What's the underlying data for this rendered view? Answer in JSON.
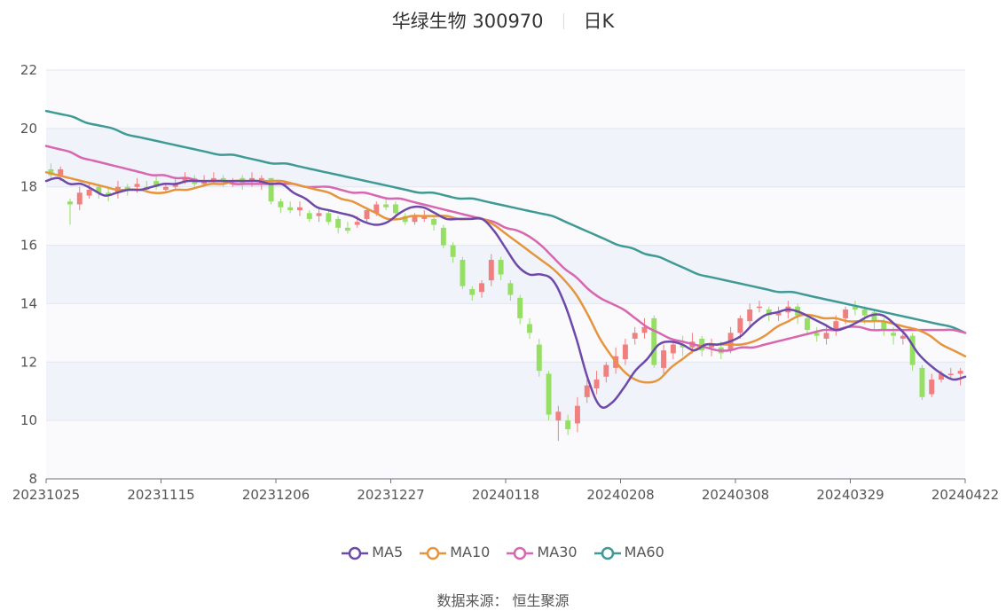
{
  "header": {
    "stock": "华绿生物 300970",
    "period": "日K"
  },
  "source_label": "数据来源：",
  "source_name": "恒生聚源",
  "colors": {
    "up": "#f07f7f",
    "down": "#95e063",
    "MA5": "#6e4aa8",
    "MA10": "#e6953d",
    "MA30": "#d767b0",
    "MA60": "#3f9a95"
  },
  "chart_data": {
    "type": "candlestick",
    "title": "华绿生物 300970 日K",
    "ylim": [
      8,
      22
    ],
    "yticks": [
      8,
      10,
      12,
      14,
      16,
      18,
      20,
      22
    ],
    "xtick_labels": [
      "20231025",
      "20231115",
      "20231206",
      "20231227",
      "20240118",
      "20240208",
      "20240308",
      "20240329",
      "20240422"
    ],
    "grid": true,
    "legend_position": "bottom",
    "series": [
      {
        "name": "MA5",
        "values": [
          18.2,
          18.3,
          18.1,
          18.1,
          17.9,
          17.7,
          17.8,
          17.9,
          17.9,
          18.0,
          18.1,
          18.1,
          18.2,
          18.2,
          18.2,
          18.2,
          18.2,
          18.2,
          18.2,
          18.1,
          18.1,
          17.8,
          17.6,
          17.3,
          17.2,
          17.1,
          17.0,
          16.8,
          16.7,
          16.8,
          17.1,
          17.3,
          17.3,
          17.1,
          16.9,
          16.9,
          16.9,
          16.9,
          16.5,
          15.9,
          15.3,
          15.0,
          15.0,
          14.8,
          14.0,
          12.8,
          11.4,
          10.5,
          10.6,
          11.1,
          11.7,
          12.1,
          12.6,
          12.7,
          12.6,
          12.4,
          12.6,
          12.6,
          12.7,
          12.9,
          13.3,
          13.6,
          13.7,
          13.8,
          13.7,
          13.5,
          13.3,
          13.1,
          13.2,
          13.4,
          13.6,
          13.6,
          13.3,
          12.9,
          12.3,
          11.9,
          11.6,
          11.4,
          11.5
        ]
      },
      {
        "name": "MA10",
        "values": [
          18.5,
          18.4,
          18.3,
          18.2,
          18.1,
          18.0,
          17.9,
          17.9,
          17.9,
          17.8,
          17.8,
          17.9,
          17.9,
          18.0,
          18.1,
          18.1,
          18.2,
          18.2,
          18.2,
          18.2,
          18.2,
          18.1,
          18.0,
          17.9,
          17.8,
          17.6,
          17.5,
          17.3,
          17.1,
          16.9,
          16.9,
          17.0,
          17.0,
          17.0,
          17.0,
          16.9,
          16.9,
          16.9,
          16.7,
          16.4,
          16.1,
          15.8,
          15.5,
          15.2,
          14.8,
          14.3,
          13.6,
          12.8,
          12.2,
          11.7,
          11.4,
          11.3,
          11.4,
          11.8,
          12.1,
          12.4,
          12.6,
          12.6,
          12.6,
          12.6,
          12.7,
          12.9,
          13.2,
          13.4,
          13.6,
          13.6,
          13.5,
          13.5,
          13.4,
          13.4,
          13.4,
          13.4,
          13.3,
          13.2,
          13.1,
          12.9,
          12.6,
          12.4,
          12.2
        ]
      },
      {
        "name": "MA30",
        "values": [
          19.4,
          19.3,
          19.2,
          19.0,
          18.9,
          18.8,
          18.7,
          18.6,
          18.5,
          18.4,
          18.4,
          18.3,
          18.3,
          18.2,
          18.2,
          18.2,
          18.1,
          18.1,
          18.1,
          18.1,
          18.1,
          18.1,
          18.0,
          18.0,
          18.0,
          17.9,
          17.8,
          17.8,
          17.7,
          17.6,
          17.6,
          17.5,
          17.4,
          17.3,
          17.2,
          17.1,
          17.0,
          16.9,
          16.8,
          16.6,
          16.5,
          16.3,
          16.0,
          15.6,
          15.2,
          14.9,
          14.5,
          14.2,
          14.0,
          13.8,
          13.5,
          13.2,
          13.0,
          12.8,
          12.7,
          12.6,
          12.5,
          12.4,
          12.4,
          12.5,
          12.5,
          12.6,
          12.7,
          12.8,
          12.9,
          13.0,
          13.1,
          13.1,
          13.2,
          13.2,
          13.1,
          13.1,
          13.1,
          13.1,
          13.1,
          13.1,
          13.1,
          13.1,
          13.0
        ]
      },
      {
        "name": "MA60",
        "values": [
          20.6,
          20.5,
          20.4,
          20.2,
          20.1,
          20.0,
          19.8,
          19.7,
          19.6,
          19.5,
          19.4,
          19.3,
          19.2,
          19.1,
          19.1,
          19.0,
          18.9,
          18.8,
          18.8,
          18.7,
          18.6,
          18.5,
          18.4,
          18.3,
          18.2,
          18.1,
          18.0,
          17.9,
          17.8,
          17.8,
          17.7,
          17.6,
          17.6,
          17.5,
          17.4,
          17.3,
          17.2,
          17.1,
          17.0,
          16.8,
          16.6,
          16.4,
          16.2,
          16.0,
          15.9,
          15.7,
          15.6,
          15.4,
          15.2,
          15.0,
          14.9,
          14.8,
          14.7,
          14.6,
          14.5,
          14.4,
          14.4,
          14.3,
          14.2,
          14.1,
          14.0,
          13.9,
          13.8,
          13.7,
          13.6,
          13.5,
          13.4,
          13.3,
          13.2,
          13.0
        ]
      },
      {
        "name": "candles",
        "ohlc": [
          [
            18.6,
            18.4,
            18.8,
            18.3
          ],
          [
            18.4,
            18.6,
            18.7,
            18.2
          ],
          [
            17.5,
            17.4,
            17.6,
            16.7
          ],
          [
            17.4,
            17.8,
            18.0,
            17.2
          ],
          [
            17.7,
            17.9,
            18.1,
            17.6
          ],
          [
            18.0,
            17.8,
            18.1,
            17.6
          ],
          [
            17.8,
            17.7,
            18.0,
            17.5
          ],
          [
            17.8,
            18.0,
            18.2,
            17.6
          ],
          [
            18.0,
            17.9,
            18.1,
            17.7
          ],
          [
            18.0,
            18.1,
            18.3,
            17.8
          ],
          [
            18.0,
            17.9,
            18.2,
            17.8
          ],
          [
            18.2,
            18.0,
            18.4,
            17.9
          ],
          [
            17.9,
            18.0,
            18.1,
            17.8
          ],
          [
            18.0,
            18.1,
            18.3,
            17.9
          ],
          [
            18.2,
            18.3,
            18.5,
            18.1
          ],
          [
            18.3,
            18.1,
            18.4,
            18.0
          ],
          [
            18.1,
            18.2,
            18.4,
            18.0
          ],
          [
            18.2,
            18.3,
            18.5,
            18.1
          ],
          [
            18.3,
            18.2,
            18.4,
            18.0
          ],
          [
            18.2,
            18.2,
            18.3,
            18.0
          ],
          [
            18.3,
            18.1,
            18.4,
            17.9
          ],
          [
            18.2,
            18.3,
            18.5,
            18.0
          ],
          [
            18.1,
            18.3,
            18.4,
            17.9
          ],
          [
            18.3,
            17.5,
            18.3,
            17.4
          ],
          [
            17.5,
            17.3,
            17.6,
            17.1
          ],
          [
            17.3,
            17.2,
            17.5,
            17.1
          ],
          [
            17.2,
            17.3,
            17.5,
            17.0
          ],
          [
            17.1,
            16.9,
            17.2,
            16.8
          ],
          [
            17.0,
            17.1,
            17.3,
            16.8
          ],
          [
            17.1,
            16.8,
            17.2,
            16.7
          ],
          [
            16.9,
            16.6,
            17.0,
            16.4
          ],
          [
            16.6,
            16.5,
            16.8,
            16.4
          ],
          [
            16.7,
            16.8,
            17.0,
            16.6
          ],
          [
            16.9,
            17.2,
            17.3,
            16.8
          ],
          [
            17.1,
            17.4,
            17.5,
            17.0
          ],
          [
            17.4,
            17.3,
            17.6,
            17.2
          ],
          [
            17.4,
            17.1,
            17.5,
            16.9
          ],
          [
            17.0,
            16.8,
            17.1,
            16.7
          ],
          [
            16.8,
            17.0,
            17.1,
            16.7
          ],
          [
            16.9,
            17.0,
            17.2,
            16.8
          ],
          [
            16.9,
            16.7,
            17.0,
            16.5
          ],
          [
            16.6,
            16.0,
            16.7,
            15.9
          ],
          [
            16.0,
            15.6,
            16.1,
            15.4
          ],
          [
            15.5,
            14.6,
            15.6,
            14.5
          ],
          [
            14.5,
            14.3,
            14.6,
            14.1
          ],
          [
            14.4,
            14.7,
            14.8,
            14.2
          ],
          [
            14.8,
            15.5,
            15.7,
            14.6
          ],
          [
            15.5,
            15.0,
            15.6,
            14.8
          ],
          [
            14.7,
            14.3,
            14.8,
            14.1
          ],
          [
            14.2,
            13.5,
            14.3,
            13.3
          ],
          [
            13.3,
            13.0,
            13.5,
            12.8
          ],
          [
            12.6,
            11.7,
            12.8,
            11.5
          ],
          [
            11.6,
            10.2,
            11.7,
            10.0
          ],
          [
            10.0,
            10.3,
            10.5,
            9.3
          ],
          [
            10.0,
            9.7,
            10.2,
            9.5
          ],
          [
            9.9,
            10.5,
            10.8,
            9.6
          ],
          [
            10.8,
            11.2,
            11.4,
            10.6
          ],
          [
            11.1,
            11.4,
            11.7,
            10.9
          ],
          [
            11.5,
            11.9,
            12.0,
            11.3
          ],
          [
            11.8,
            12.2,
            12.5,
            11.6
          ],
          [
            12.1,
            12.6,
            12.8,
            11.9
          ],
          [
            12.8,
            13.0,
            13.2,
            12.6
          ],
          [
            13.0,
            13.2,
            13.5,
            12.8
          ],
          [
            13.5,
            11.9,
            13.6,
            11.8
          ],
          [
            11.8,
            12.4,
            12.6,
            11.6
          ],
          [
            12.3,
            12.6,
            12.8,
            12.1
          ],
          [
            12.6,
            12.5,
            12.9,
            12.2
          ],
          [
            12.5,
            12.7,
            13.0,
            12.3
          ],
          [
            12.8,
            12.4,
            12.9,
            12.2
          ],
          [
            12.5,
            12.6,
            12.8,
            12.2
          ],
          [
            12.5,
            12.3,
            12.7,
            12.1
          ],
          [
            12.4,
            13.0,
            13.2,
            12.3
          ],
          [
            13.0,
            13.5,
            13.6,
            12.8
          ],
          [
            13.4,
            13.8,
            14.0,
            13.2
          ],
          [
            13.9,
            13.9,
            14.1,
            13.7
          ],
          [
            13.8,
            13.6,
            13.9,
            13.4
          ],
          [
            13.6,
            13.7,
            13.9,
            13.4
          ],
          [
            13.7,
            13.9,
            14.1,
            13.5
          ],
          [
            13.9,
            13.6,
            14.0,
            13.3
          ],
          [
            13.5,
            13.1,
            13.6,
            12.9
          ],
          [
            13.0,
            12.9,
            13.2,
            12.7
          ],
          [
            12.8,
            13.0,
            13.3,
            12.6
          ],
          [
            13.1,
            13.4,
            13.6,
            12.9
          ],
          [
            13.5,
            13.8,
            13.9,
            13.3
          ],
          [
            13.9,
            13.8,
            14.1,
            13.6
          ],
          [
            13.8,
            13.6,
            13.9,
            13.3
          ],
          [
            13.7,
            13.4,
            13.8,
            13.1
          ],
          [
            13.4,
            13.1,
            13.5,
            12.9
          ],
          [
            13.0,
            12.9,
            13.2,
            12.6
          ],
          [
            12.8,
            12.9,
            13.1,
            12.6
          ],
          [
            12.9,
            11.9,
            13.0,
            11.7
          ],
          [
            11.8,
            10.8,
            11.9,
            10.7
          ],
          [
            10.9,
            11.4,
            11.6,
            10.8
          ],
          [
            11.4,
            11.6,
            11.7,
            11.3
          ],
          [
            11.6,
            11.6,
            11.8,
            11.4
          ],
          [
            11.6,
            11.7,
            11.8,
            11.2
          ]
        ]
      }
    ]
  }
}
